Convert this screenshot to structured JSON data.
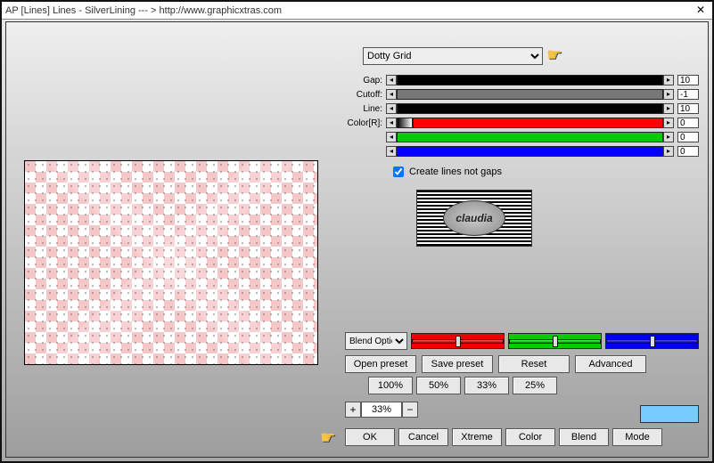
{
  "window": {
    "title": "AP [Lines]  Lines - SilverLining   --- >  http://www.graphicxtras.com"
  },
  "preset": {
    "selected": "Dotty Grid"
  },
  "sliders": {
    "gap": {
      "label": "Gap:",
      "value": "10"
    },
    "cutoff": {
      "label": "Cutoff:",
      "value": "-1"
    },
    "line": {
      "label": "Line:",
      "value": "10"
    },
    "colorR": {
      "label": "Color[R]:",
      "value": "0"
    },
    "colorG": {
      "label": "",
      "value": "0"
    },
    "colorB": {
      "label": "",
      "value": "0"
    }
  },
  "checkbox": {
    "createLines": {
      "label": "Create lines not gaps",
      "checked": true
    }
  },
  "logo_text": "claudia",
  "blend": {
    "selected": "Blend Options"
  },
  "buttons": {
    "openPreset": "Open preset",
    "savePreset": "Save preset",
    "reset": "Reset",
    "advanced": "Advanced",
    "p100": "100%",
    "p50": "50%",
    "p33": "33%",
    "p25": "25%",
    "ok": "OK",
    "cancel": "Cancel",
    "xtreme": "Xtreme",
    "color": "Color",
    "blend": "Blend",
    "mode": "Mode"
  },
  "zoom": {
    "value": "33%"
  },
  "swatch_color": "#66ccff"
}
